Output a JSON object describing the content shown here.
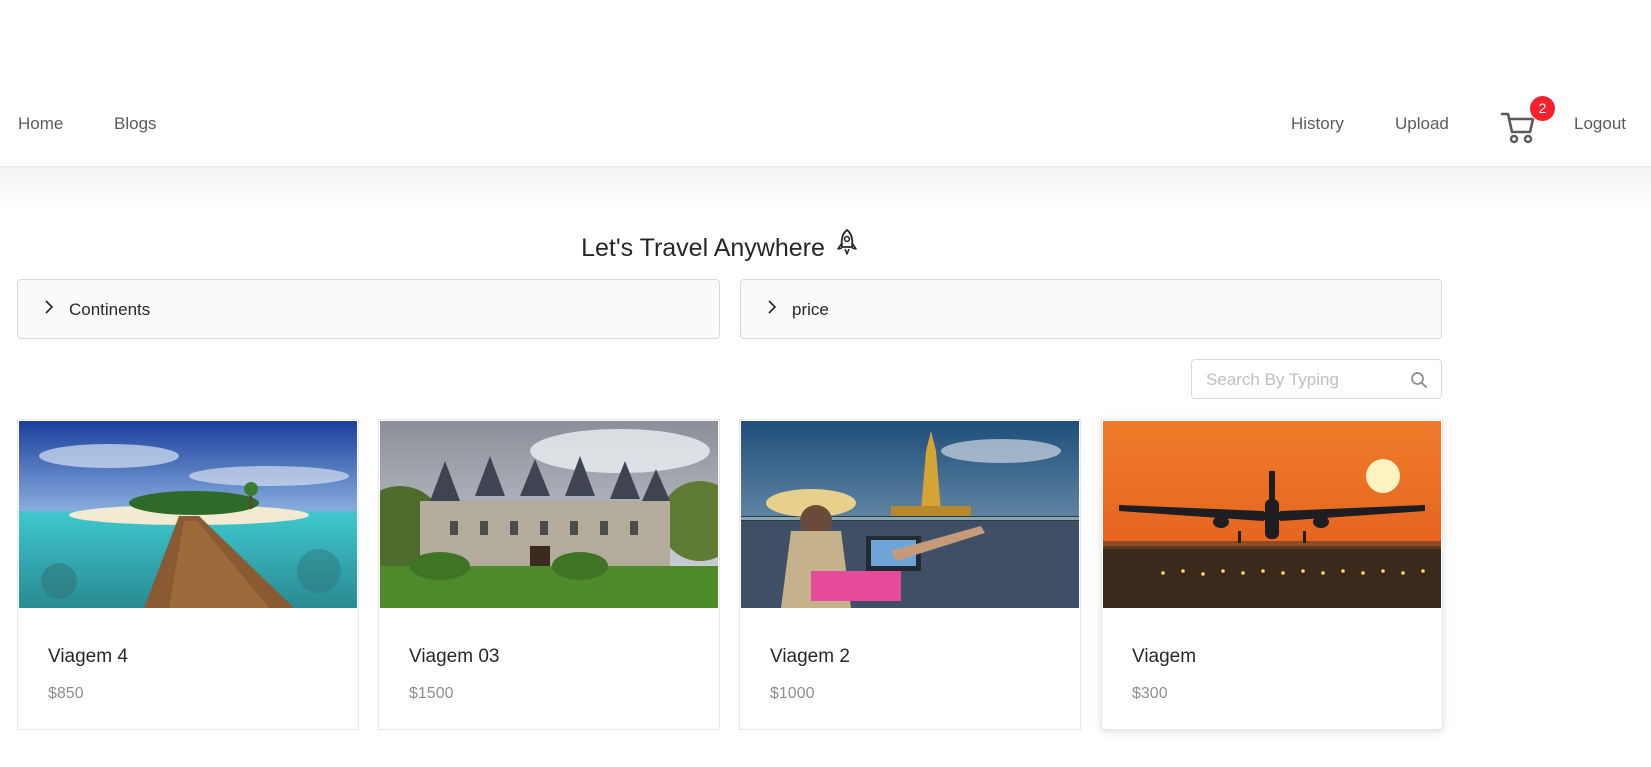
{
  "nav": {
    "left": [
      {
        "label": "Home"
      },
      {
        "label": "Blogs"
      }
    ],
    "right": [
      {
        "label": "History"
      },
      {
        "label": "Upload"
      }
    ],
    "cart_count": "2",
    "logout": "Logout"
  },
  "page": {
    "title": "Let's Travel Anywhere"
  },
  "filters": {
    "continents": "Continents",
    "price": "price"
  },
  "search": {
    "placeholder": "Search By Typing",
    "value": ""
  },
  "cards": [
    {
      "title": "Viagem 4",
      "price": "$850",
      "image": "tropical-island-pier"
    },
    {
      "title": "Viagem 03",
      "price": "$1500",
      "image": "castle"
    },
    {
      "title": "Viagem 2",
      "price": "$1000",
      "image": "woman-laptop-pagoda"
    },
    {
      "title": "Viagem",
      "price": "$300",
      "image": "airplane-sunset"
    }
  ],
  "colors": {
    "badge": "#f5222d",
    "border": "#d9d9d9",
    "panel_bg": "#fafafa"
  }
}
